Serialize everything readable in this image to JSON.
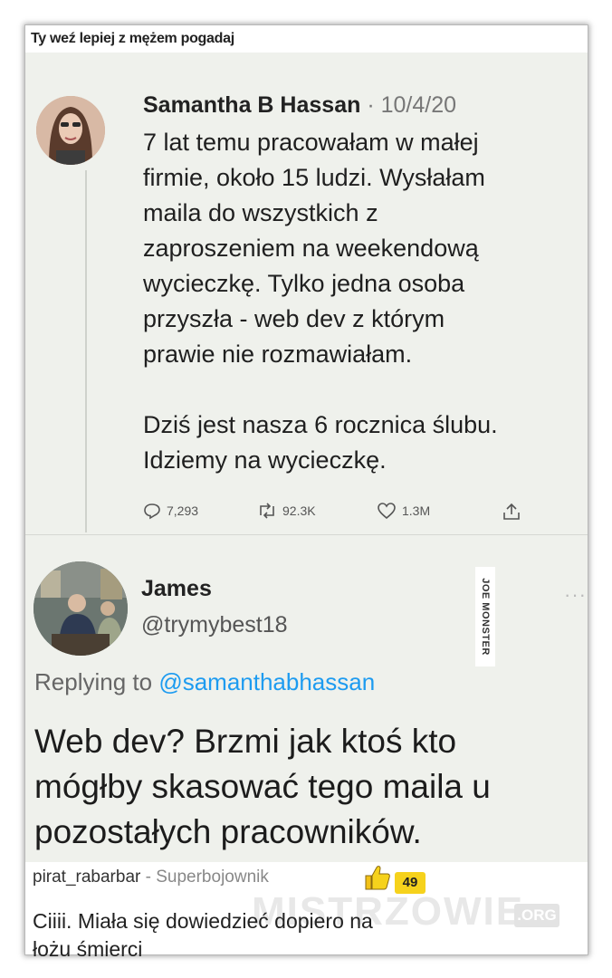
{
  "page": {
    "title": "Ty weź lepiej z mężem pogadaj"
  },
  "tweet1": {
    "author": "Samantha B Hassan",
    "separator": "·",
    "date": "10/4/20",
    "paragraph1": "7 lat temu pracowałam w małej\nfirmie, około 15 ludzi. Wysłałam\nmaila do wszystkich z\nzaproszeniem na weekendową\nwycieczkę. Tylko jedna osoba\nprzyszła - web dev z którym\nprawie nie rozmawiałam.",
    "paragraph2": "Dziś jest nasza 6 rocznica ślubu.\nIdziemy na wycieczkę.",
    "replies": "7,293",
    "retweets": "92.3K",
    "likes": "1.3M"
  },
  "tweet2": {
    "author": "James",
    "handle": "@trymybest18",
    "replying_prefix": "Replying to ",
    "replying_to": "@samanthabhassan",
    "text": "Web dev? Brzmi jak ktoś kto\nmógłby skasować tego maila u\npozostałych pracowników."
  },
  "watermarks": {
    "side": "JOE MONSTER",
    "site": "MISTRZOWIE",
    "site_tld": ".ORG"
  },
  "comment": {
    "user": "pirat_rabarbar",
    "separator": " - ",
    "rank": "Superbojownik",
    "score": "49",
    "text": "Ciiii. Miała się dowiedzieć dopiero na\nłożu śmierci"
  },
  "colors": {
    "link": "#1d9bf0",
    "score_badge": "#f6d21c",
    "tweet_bg": "#eff1ec"
  }
}
